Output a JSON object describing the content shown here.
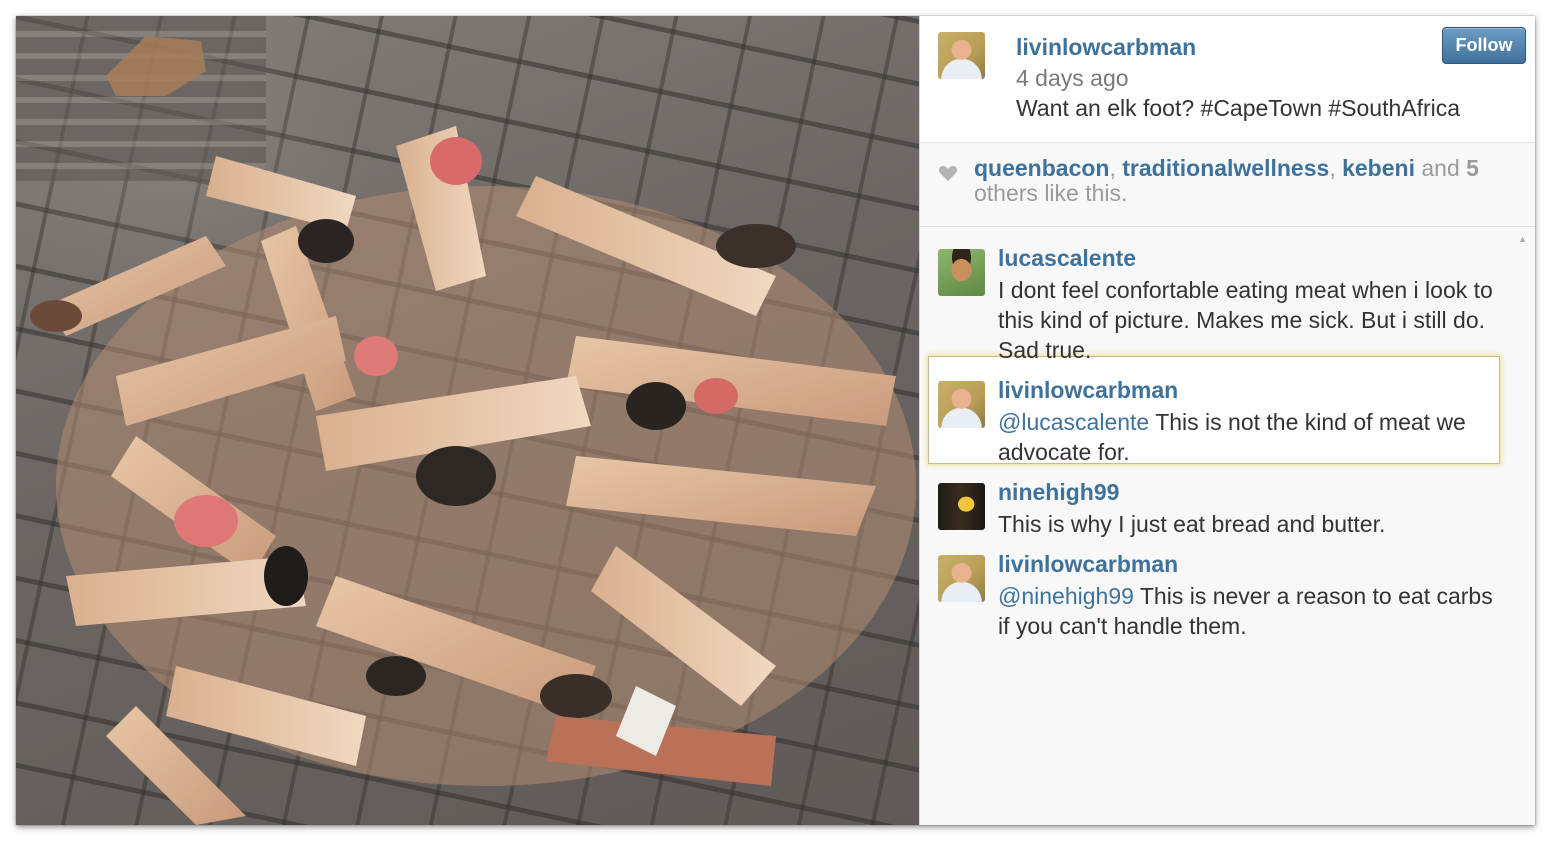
{
  "post": {
    "username": "livinlowcarbman",
    "time_ago": "4 days ago",
    "caption": "Want an elk foot? #CapeTown #SouthAfrica",
    "follow_label": "Follow"
  },
  "likes": {
    "users": [
      "queenbacon",
      "traditionalwellness",
      "kebeni"
    ],
    "sep": ", ",
    "and": " and ",
    "others_count": "5",
    "others_text": " others like this."
  },
  "comments": [
    {
      "username": "lucascalente",
      "mention": "",
      "text": "I dont feel confortable eating meat when i look to this kind of picture. Makes me sick. But i still do. Sad true.",
      "highlighted": false
    },
    {
      "username": "livinlowcarbman",
      "mention": "@lucascalente",
      "text": " This is not the kind of meat we advocate for.",
      "highlighted": true
    },
    {
      "username": "ninehigh99",
      "mention": "",
      "text": "This is why I just eat bread and butter.",
      "highlighted": false
    },
    {
      "username": "livinlowcarbman",
      "mention": "@ninehigh99",
      "text": " This is never a reason to eat carbs if you can't handle them.",
      "highlighted": false
    }
  ],
  "colors": {
    "link": "#3f729b",
    "muted": "#9a9a9a",
    "text": "#333333",
    "highlight_border": "#ebcd5a"
  },
  "icons": {
    "heart": "heart-icon",
    "scroll_up": "scroll-up-arrow-icon"
  }
}
